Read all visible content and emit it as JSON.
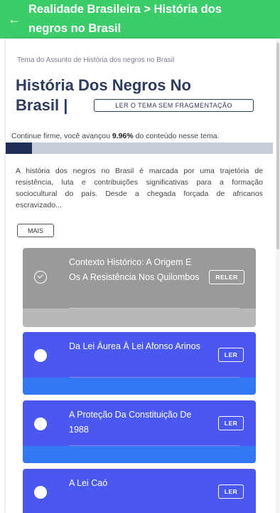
{
  "appbar": {
    "back_icon": "arrow-left-icon",
    "title": "Realidade Brasileira > História dos negros no Brasil"
  },
  "header": {
    "subtitle": "Tema do Assunto de História dos negros no Brasil",
    "title": "História Dos Negros No Brasil |",
    "read_full_label": "LER O TEMA SEM FRAGMENTAÇÃO"
  },
  "progress": {
    "text_before": "Continue firme, você avançou ",
    "percent_label": "9.96%",
    "text_after": " do conteúdo nesse tema.",
    "value_percent": 9.96,
    "color_fill": "#1f2f55",
    "color_track": "#c7ceda"
  },
  "description": {
    "text": "A história dos negros no Brasil é marcada por uma trajetória de resistência, luta e contribuições significativas para a formação sociocultural do país. Desde a chegada forçada de africanos escravizado...",
    "more_label": "MAIS"
  },
  "topics": [
    {
      "title": "Contexto Histórico: A Origem E Os A Resistência Nos Quilombos",
      "button_label": "RELER",
      "status": "completed",
      "icon": "check-circle-icon"
    },
    {
      "title": "Da Lei Áurea  À Lei Afonso Arinos",
      "button_label": "LER",
      "status": "pending",
      "icon": "circle-icon"
    },
    {
      "title": "A Proteção Da Constituição De 1988",
      "button_label": "LER",
      "status": "pending",
      "icon": "circle-icon"
    },
    {
      "title": "A Lei Caó",
      "button_label": "LER",
      "status": "pending",
      "icon": "circle-icon"
    }
  ],
  "colors": {
    "appbar": "#3ccd6a",
    "title": "#2f3d5c",
    "card_done": "#9a9a9a",
    "card_pending": "#4b58f0",
    "card_pending_footer": "#3477f2"
  }
}
